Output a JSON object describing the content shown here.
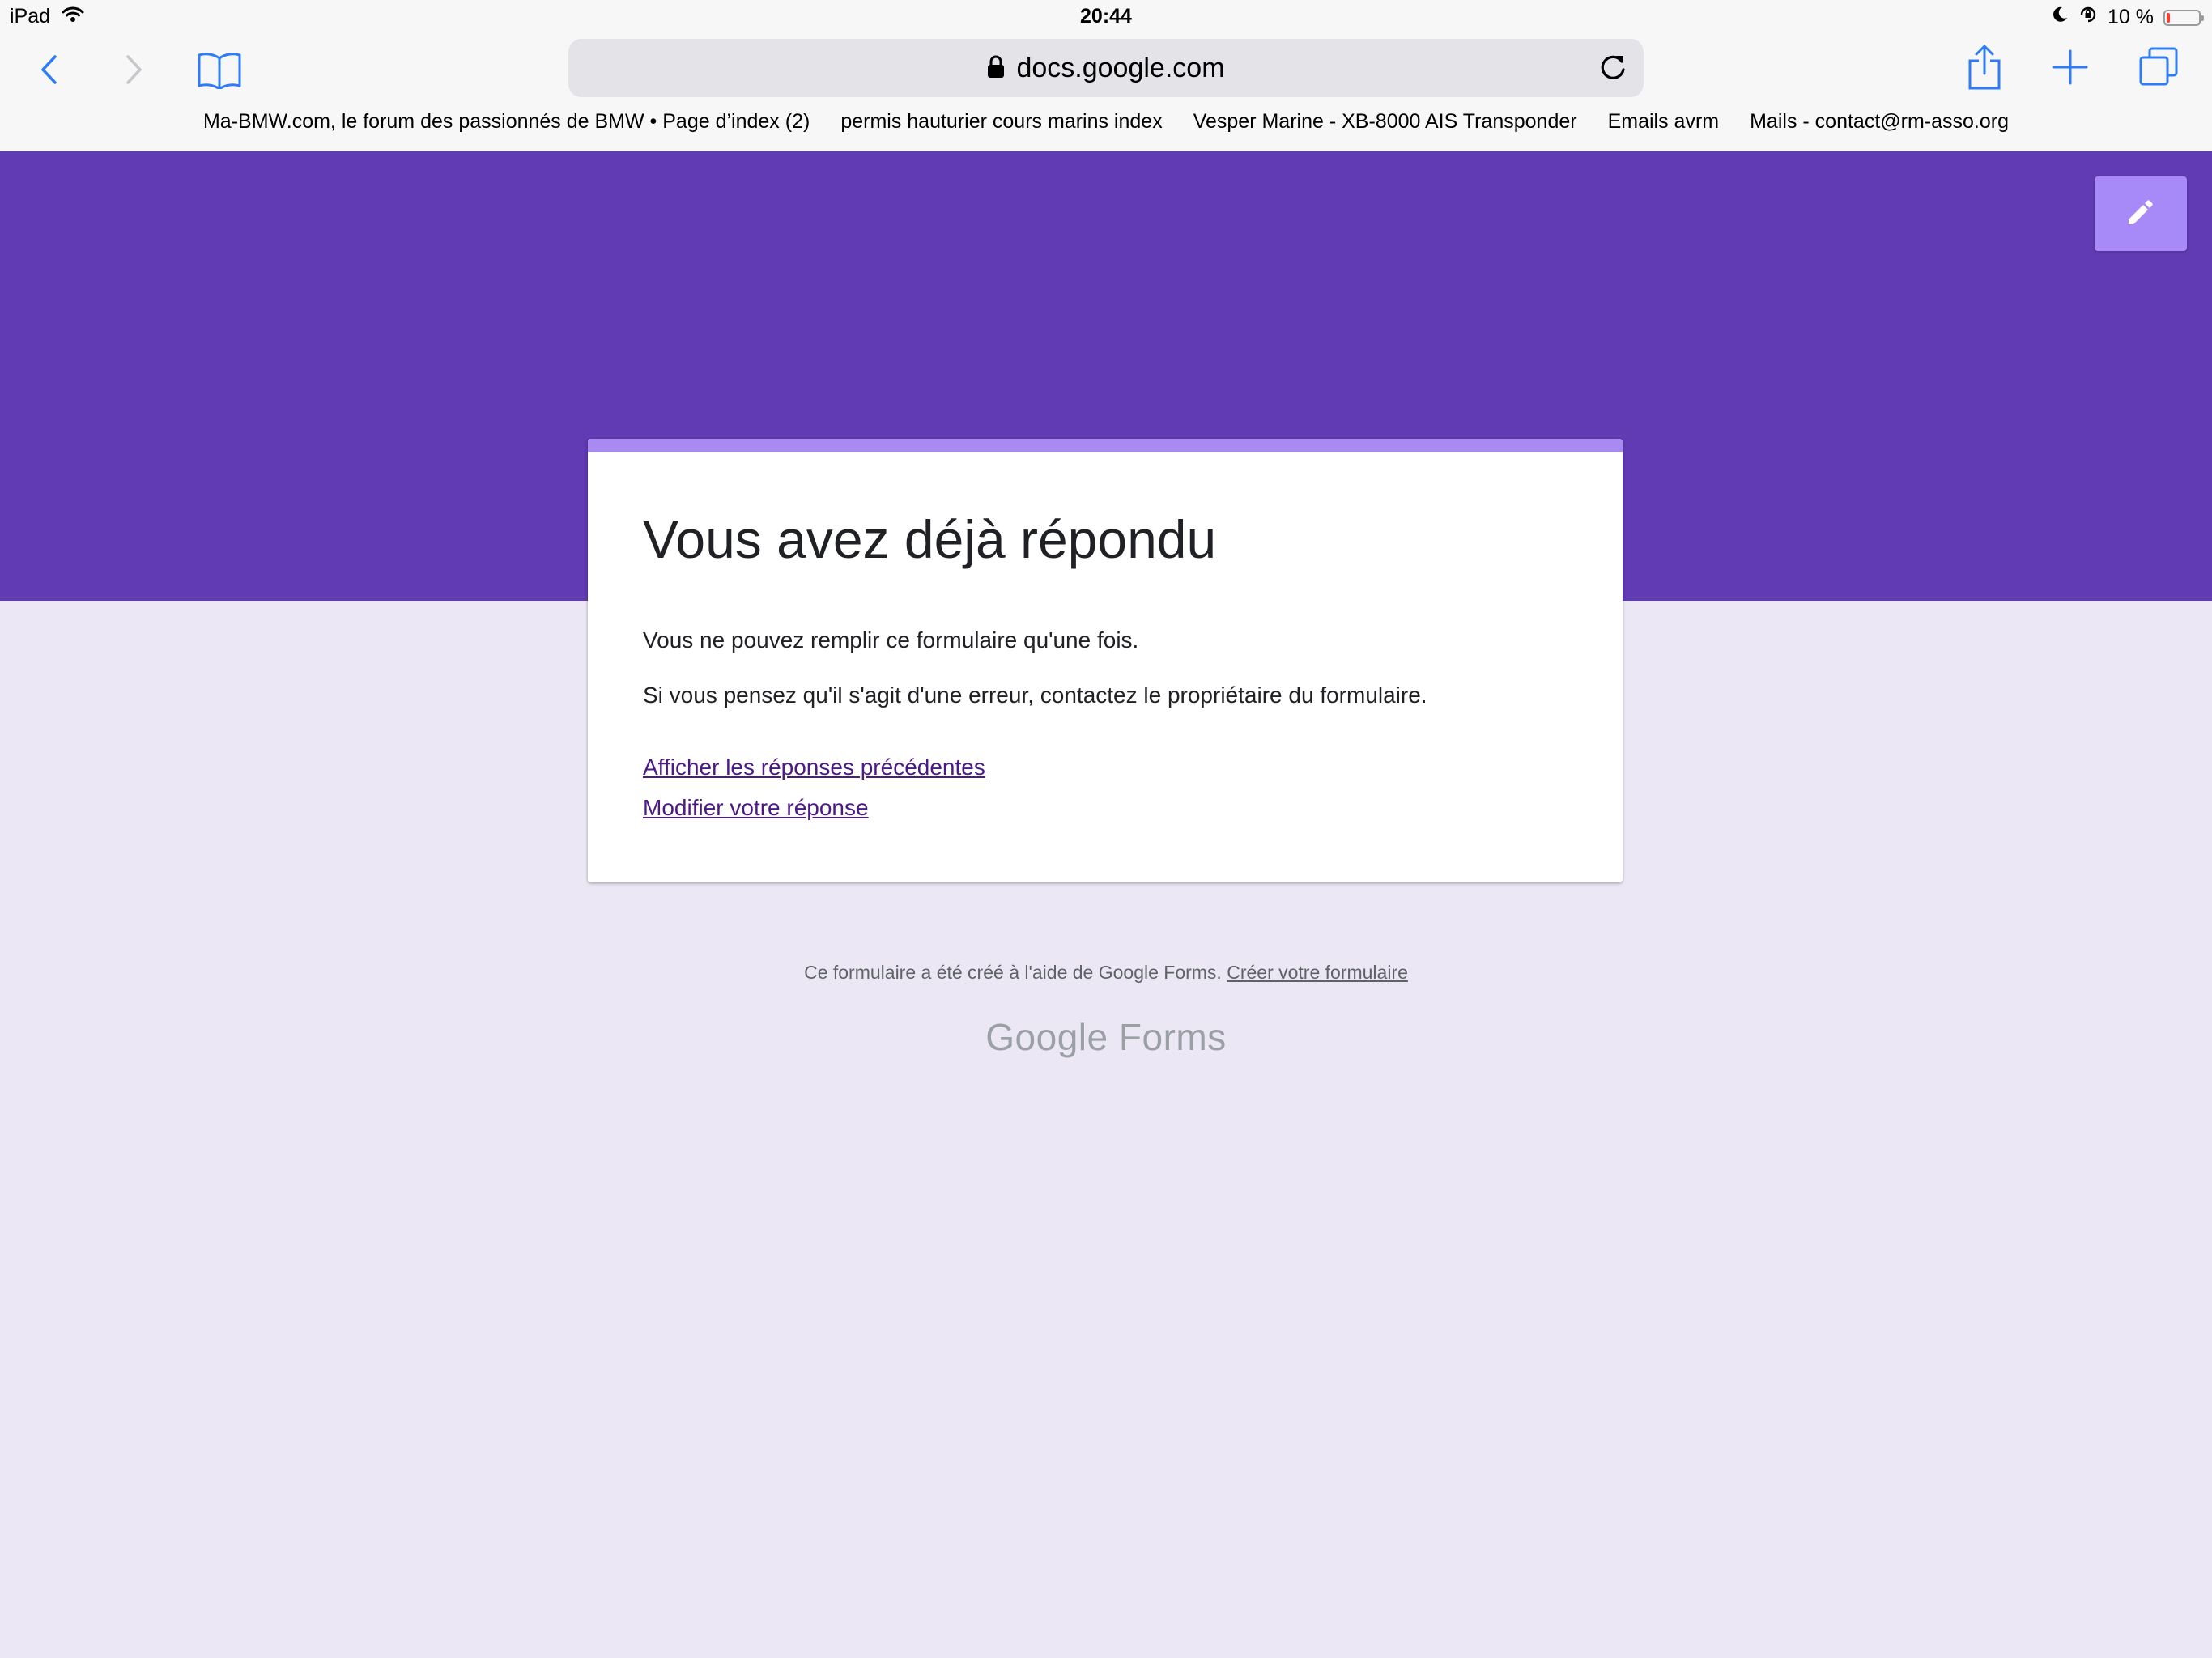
{
  "status_bar": {
    "device": "iPad",
    "time": "20:44",
    "battery_text": "10 %",
    "battery_level": 0.1,
    "icons": [
      "wifi-icon",
      "moon-icon",
      "orientation-lock-icon",
      "battery-icon"
    ]
  },
  "toolbar": {
    "url": "docs.google.com",
    "icons": [
      "back-icon",
      "forward-icon",
      "bookmarks-icon",
      "lock-icon",
      "reload-icon",
      "share-icon",
      "new-tab-icon",
      "tabs-icon"
    ],
    "accent_color": "#2f7cf6"
  },
  "bookmarks": [
    "Ma-BMW.com, le forum des passionnés de BMW • Page d’index (2)",
    "permis hauturier cours marins index",
    "Vesper Marine - XB-8000 AIS Transponder",
    "Emails avrm",
    "Mails - contact@rm-asso.org"
  ],
  "form": {
    "banner_color": "#613bb3",
    "accent_color": "#a98af2",
    "edit_icon": "pencil-icon",
    "title": "Vous avez déjà répondu",
    "message1": "Vous ne pouvez remplir ce formulaire qu'une fois.",
    "message2": "Si vous pensez qu'il s'agit d'une erreur, contactez le propriétaire du formulaire.",
    "link_previous": "Afficher les réponses précédentes",
    "link_edit": "Modifier votre réponse"
  },
  "footer": {
    "text": "Ce formulaire a été créé à l'aide de Google Forms.",
    "link": "Créer votre formulaire",
    "logo_google": "Google",
    "logo_forms": "Forms"
  }
}
